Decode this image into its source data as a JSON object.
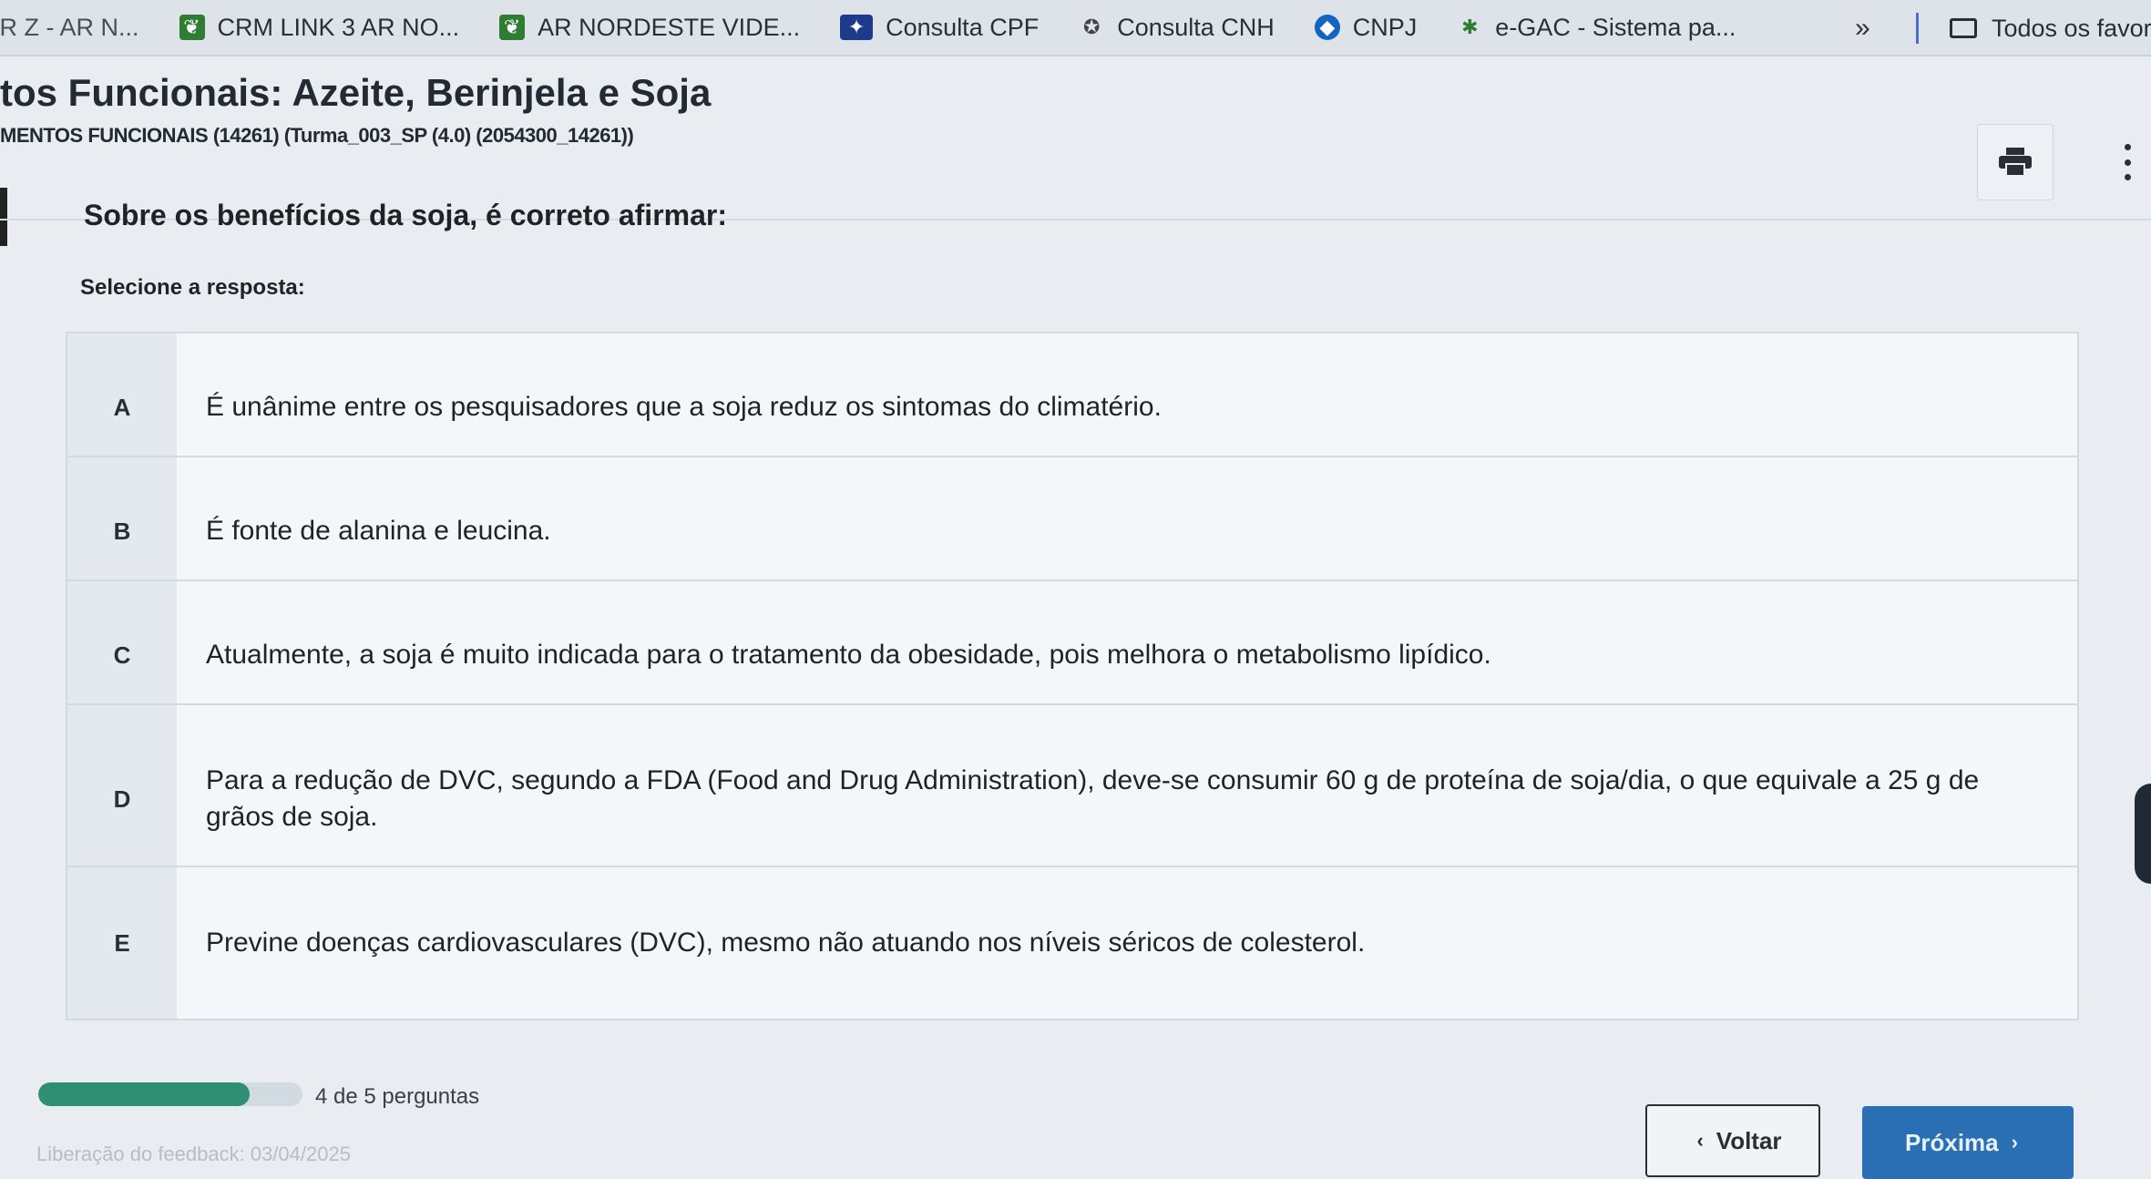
{
  "bookmarks": {
    "items": [
      {
        "label": "NR Z - AR N...",
        "icon": "bookmark-icon",
        "color": "#555555"
      },
      {
        "label": "CRM LINK 3 AR NO...",
        "icon": "leaf-icon",
        "color": "#2e7d32"
      },
      {
        "label": "AR NORDESTE VIDE...",
        "icon": "leaf-icon",
        "color": "#2e7d32"
      },
      {
        "label": "Consulta CPF",
        "icon": "flag-icon",
        "color": "#1e3a8a"
      },
      {
        "label": "Consulta CNH",
        "icon": "badge-icon",
        "color": "#555555"
      },
      {
        "label": "CNPJ",
        "icon": "globe-icon",
        "color": "#1565c0"
      },
      {
        "label": "e-GAC - Sistema pa...",
        "icon": "star-icon",
        "color": "#2e7d32"
      }
    ],
    "more_label": "»",
    "all_label": "Todos os favoritos"
  },
  "header": {
    "title": "tos Funcionais: Azeite, Berinjela e Soja",
    "subtitle": "MENTOS FUNCIONAIS (14261) (Turma_003_SP (4.0) (2054300_14261))"
  },
  "question": {
    "text": "Sobre os benefícios da soja, é correto afirmar:",
    "prompt": "Selecione a resposta:",
    "options": [
      {
        "letter": "A",
        "text": "É unânime entre os pesquisadores que a soja reduz os sintomas do climatério."
      },
      {
        "letter": "B",
        "text": "É fonte de alanina e leucina."
      },
      {
        "letter": "C",
        "text": "Atualmente, a soja é muito indicada para o tratamento da obesidade, pois melhora o metabolismo lipídico."
      },
      {
        "letter": "D",
        "text": "Para a redução de DVC, segundo a FDA (Food and Drug Administration), deve-se consumir 60 g de proteína de soja/dia, o que equivale a 25 g de grãos de soja."
      },
      {
        "letter": "E",
        "text": "Previne doenças cardiovasculares (DVC), mesmo não atuando nos níveis séricos de colesterol."
      }
    ]
  },
  "footer": {
    "progress_text": "4 de 5 perguntas",
    "progress_fraction": 0.8,
    "faded_text": "Liberação do feedback: 03/04/2025",
    "back_label": "Voltar",
    "next_label": "Próxima"
  },
  "colors": {
    "accent": "#2a6fb3",
    "progress": "#2f8f73"
  }
}
